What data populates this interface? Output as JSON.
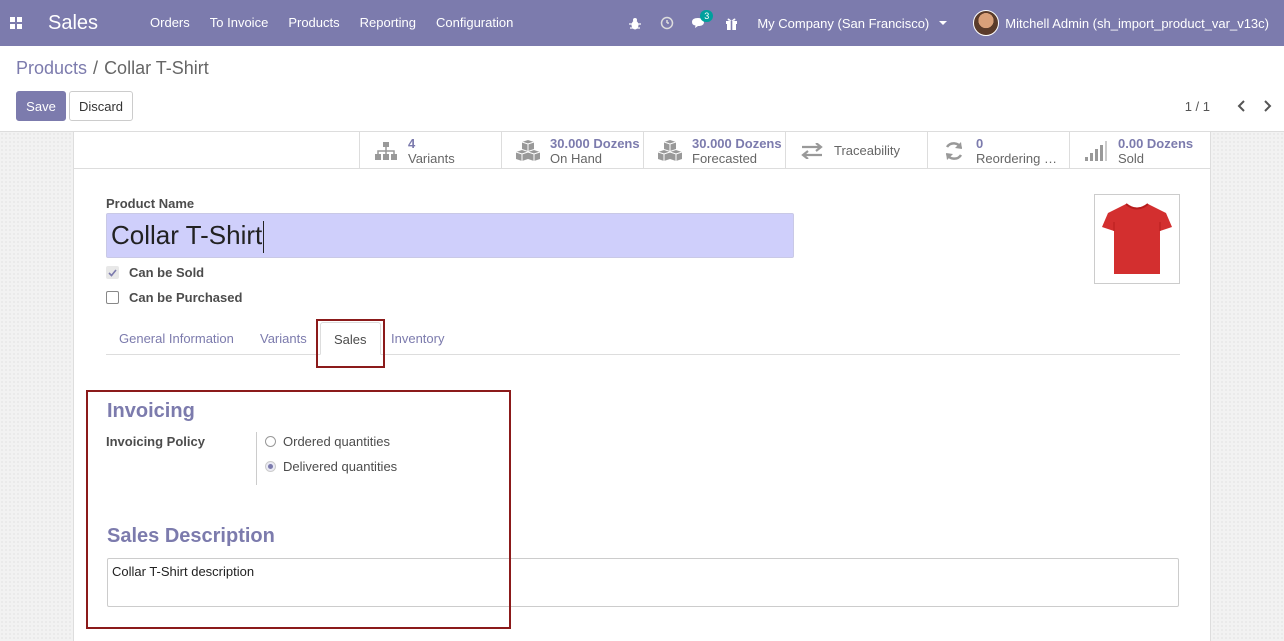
{
  "navbar": {
    "brand": "Sales",
    "menu": [
      {
        "label": "Orders"
      },
      {
        "label": "To Invoice"
      },
      {
        "label": "Products"
      },
      {
        "label": "Reporting"
      },
      {
        "label": "Configuration"
      }
    ],
    "messages_count": "3",
    "company": "My Company (San Francisco)",
    "user": "Mitchell Admin (sh_import_product_var_v13c)"
  },
  "breadcrumb": {
    "parent": "Products",
    "separator": "/",
    "current": "Collar T-Shirt"
  },
  "actions": {
    "save_label": "Save",
    "discard_label": "Discard"
  },
  "pager": {
    "value": "1 / 1"
  },
  "smart_buttons": [
    {
      "value": "4",
      "label": "Variants",
      "icon": "sitemap-icon"
    },
    {
      "value": "30.000 Dozens",
      "label": "On Hand",
      "icon": "cubes-icon"
    },
    {
      "value": "30.000 Dozens",
      "label": "Forecasted",
      "icon": "cubes-icon"
    },
    {
      "label": "Traceability",
      "icon": "exchange-icon"
    },
    {
      "value": "0",
      "label": "Reordering Rules",
      "icon": "refresh-icon"
    },
    {
      "value": "0.00 Dozens",
      "label": "Sold",
      "icon": "signal-icon"
    }
  ],
  "form": {
    "product_name_label": "Product Name",
    "product_name": "Collar T-Shirt",
    "can_be_sold_label": "Can be Sold",
    "can_be_sold": true,
    "can_be_purchased_label": "Can be Purchased",
    "can_be_purchased": false,
    "image": "red-tshirt"
  },
  "tabs": [
    {
      "label": "General Information",
      "active": false
    },
    {
      "label": "Variants",
      "active": false
    },
    {
      "label": "Sales",
      "active": true
    },
    {
      "label": "Inventory",
      "active": false
    }
  ],
  "sales_tab": {
    "invoicing_title": "Invoicing",
    "invoicing_policy_label": "Invoicing Policy",
    "policy_options": [
      {
        "label": "Ordered quantities",
        "selected": false
      },
      {
        "label": "Delivered quantities",
        "selected": true
      }
    ],
    "sales_description_title": "Sales Description",
    "sales_description": "Collar T-Shirt description"
  },
  "colors": {
    "brand": "#7c7bad",
    "highlight": "#8b1a1a",
    "input_bg": "#cfcffb",
    "tshirt": "#d32f2f"
  }
}
